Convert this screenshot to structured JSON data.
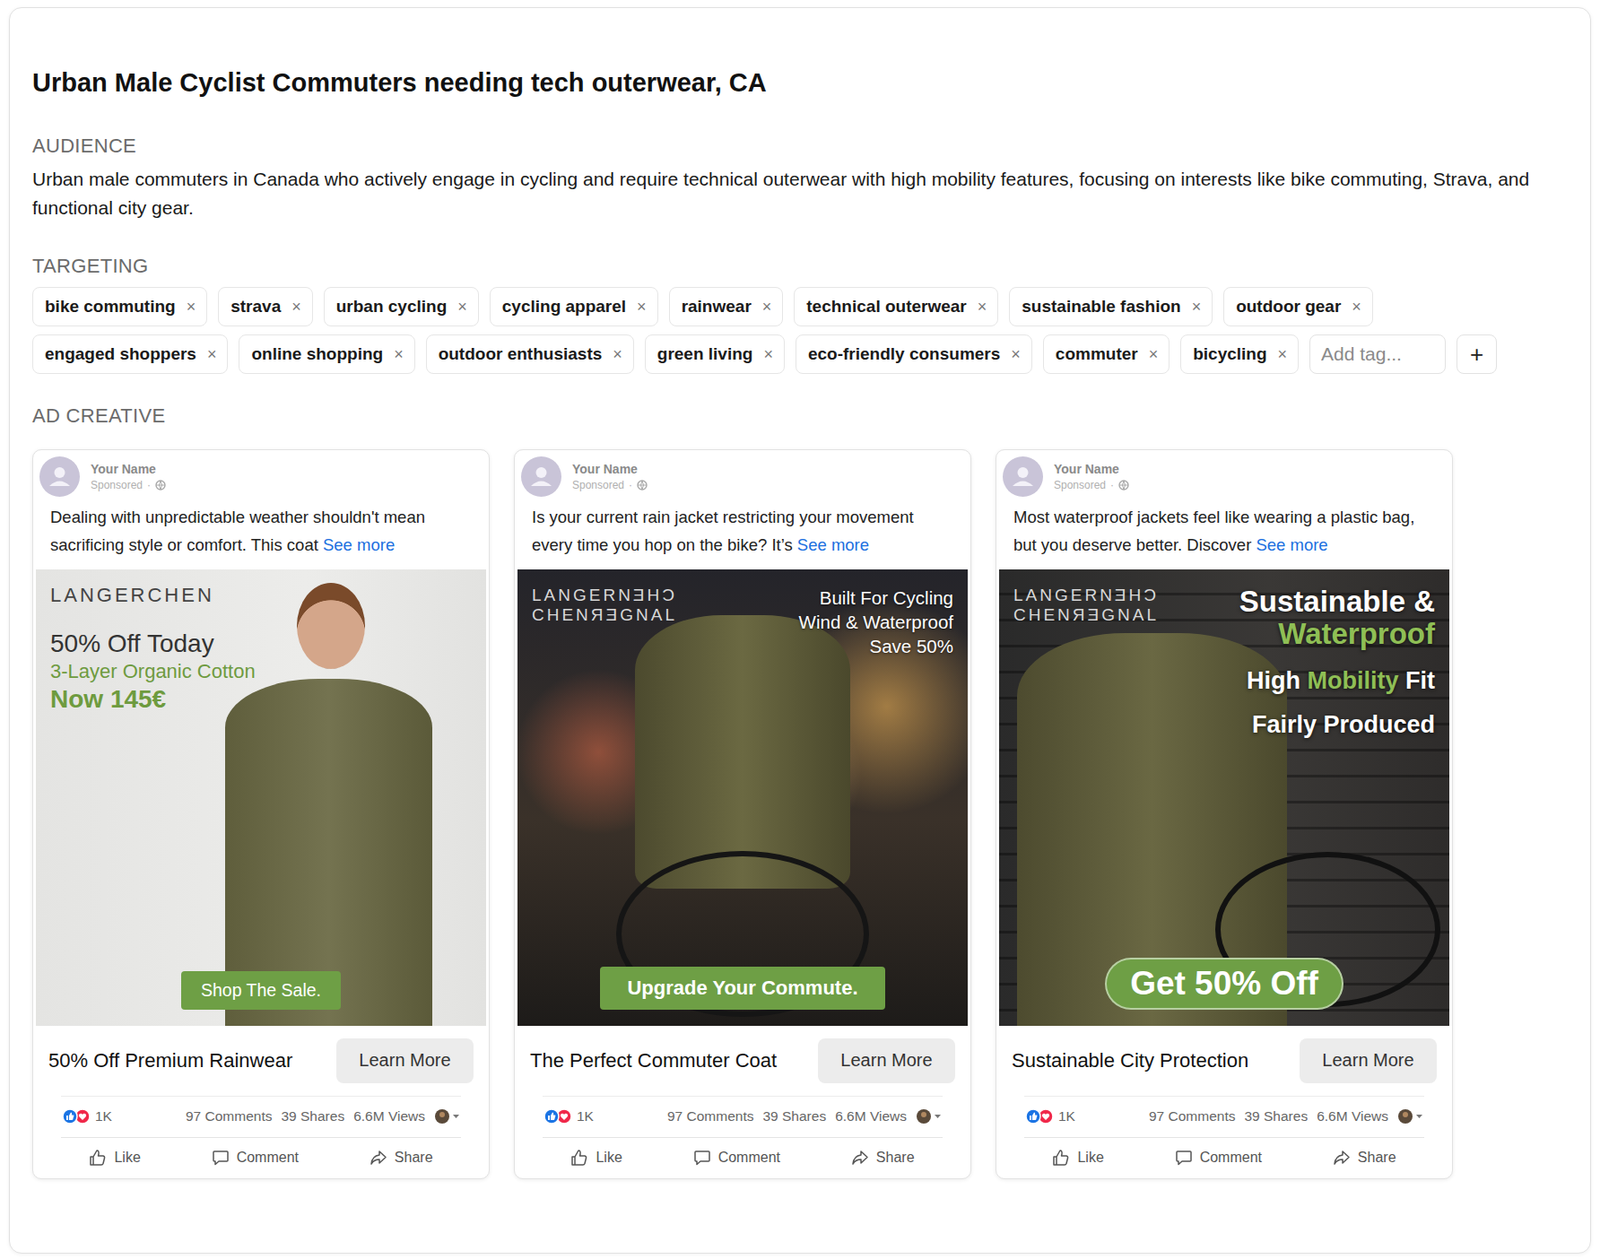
{
  "campaign": {
    "title": "Urban Male Cyclist Commuters needing tech outerwear, CA"
  },
  "audience": {
    "heading": "AUDIENCE",
    "text": "Urban male commuters in Canada who actively engage in cycling and require technical outerwear with high mobility features, focusing on interests like bike commuting, Strava, and functional city gear."
  },
  "targeting": {
    "heading": "TARGETING",
    "remove": "×",
    "add_placeholder": "Add tag...",
    "add_button": "+",
    "tags": [
      {
        "label": "bike commuting"
      },
      {
        "label": "strava"
      },
      {
        "label": "urban cycling"
      },
      {
        "label": "cycling apparel"
      },
      {
        "label": "rainwear"
      },
      {
        "label": "technical outerwear"
      },
      {
        "label": "sustainable fashion"
      },
      {
        "label": "outdoor gear"
      },
      {
        "label": "engaged shoppers"
      },
      {
        "label": "online shopping"
      },
      {
        "label": "outdoor enthusiasts"
      },
      {
        "label": "green living"
      },
      {
        "label": "eco-friendly consumers"
      },
      {
        "label": "commuter"
      },
      {
        "label": "bicycling"
      }
    ]
  },
  "creative": {
    "heading": "AD CREATIVE",
    "ads": [
      {
        "kind": "studio",
        "author": "Your Name",
        "sponsored": "Sponsored",
        "separator": "·",
        "text": "Dealing with unpredictable weather shouldn't mean sacrificing style or comfort. This coat",
        "see_more": "See more",
        "logo": [
          "LANGERCHEN"
        ],
        "lines": [
          {
            "bold": false,
            "parts": [
              {
                "text": "50% Off Today",
                "accent": false
              }
            ]
          },
          {
            "bold": false,
            "parts": [
              {
                "text": "3-Layer Organic Cotton",
                "accent": true
              }
            ]
          },
          {
            "bold": true,
            "parts": [
              {
                "text": "Now 145€",
                "accent": true
              }
            ]
          }
        ],
        "cta": "Shop The Sale.",
        "headline": "50% Off Premium Rainwear",
        "button": "Learn More",
        "reactions": "1K",
        "comments": "97 Comments",
        "shares": "39 Shares",
        "views": "6.6M Views",
        "actions": [
          "Like",
          "Comment",
          "Share"
        ]
      },
      {
        "kind": "street",
        "author": "Your Name",
        "sponsored": "Sponsored",
        "separator": "·",
        "text": "Is your current rain jacket restricting your movement every time you hop on the bike? It’s",
        "see_more": "See more",
        "logo": [
          "LANGERNƎHƆ",
          "CHENЯƎGNAL"
        ],
        "lines": [
          {
            "bold": false,
            "parts": [
              {
                "text": "Built For Cycling",
                "accent": false
              }
            ]
          },
          {
            "bold": false,
            "parts": [
              {
                "text": "Wind & Waterproof",
                "accent": false
              }
            ]
          },
          {
            "bold": false,
            "parts": [
              {
                "text": "Save 50%",
                "accent": false
              }
            ]
          }
        ],
        "cta": "Upgrade Your Commute.",
        "headline": "The Perfect Commuter Coat",
        "button": "Learn More",
        "reactions": "1K",
        "comments": "97 Comments",
        "shares": "39 Shares",
        "views": "6.6M Views",
        "actions": [
          "Like",
          "Comment",
          "Share"
        ]
      },
      {
        "kind": "wall",
        "author": "Your Name",
        "sponsored": "Sponsored",
        "separator": "·",
        "text": "Most waterproof jackets feel like wearing a plastic bag, but you deserve better. Discover",
        "see_more": "See more",
        "logo": [
          "LANGERNƎHƆ",
          "CHENЯƎGNAL"
        ],
        "lines": [
          {
            "bold": true,
            "parts": [
              {
                "text": "Sustainable &",
                "accent": false
              }
            ]
          },
          {
            "bold": true,
            "parts": [
              {
                "text": "Waterproof",
                "accent": true
              }
            ]
          },
          {
            "bold": true,
            "parts": [
              {
                "text": "High ",
                "accent": false
              },
              {
                "text": "Mobility",
                "accent": true
              },
              {
                "text": " Fit",
                "accent": false
              }
            ]
          },
          {
            "bold": true,
            "parts": [
              {
                "text": "Fairly Produced",
                "accent": false
              }
            ]
          }
        ],
        "cta": "Get 50% Off",
        "headline": "Sustainable City Protection",
        "button": "Learn More",
        "reactions": "1K",
        "comments": "97 Comments",
        "shares": "39 Shares",
        "views": "6.6M Views",
        "actions": [
          "Like",
          "Comment",
          "Share"
        ]
      }
    ]
  }
}
